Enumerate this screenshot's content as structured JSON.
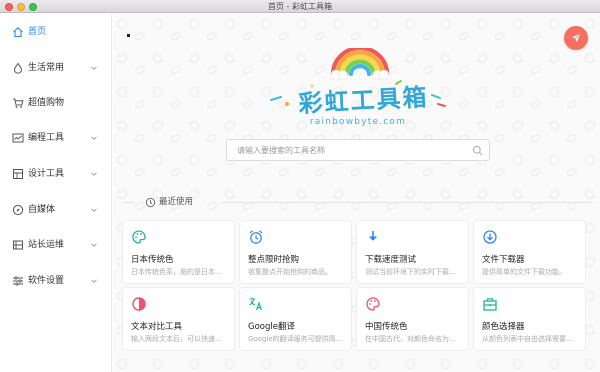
{
  "window": {
    "title": "首页 - 彩虹工具箱"
  },
  "sidebar": {
    "items": [
      {
        "label": "首页",
        "icon": "home-icon",
        "active": true
      },
      {
        "label": "生活常用",
        "icon": "water-drop-icon",
        "expandable": true
      },
      {
        "label": "超值购物",
        "icon": "cart-icon"
      },
      {
        "label": "编程工具",
        "icon": "code-window-icon",
        "expandable": true
      },
      {
        "label": "设计工具",
        "icon": "design-icon",
        "expandable": true
      },
      {
        "label": "自媒体",
        "icon": "compass-icon",
        "expandable": true
      },
      {
        "label": "站长运维",
        "icon": "server-icon",
        "expandable": true
      },
      {
        "label": "软件设置",
        "icon": "sliders-icon",
        "expandable": true
      }
    ]
  },
  "logo": {
    "name": "彩虹工具箱",
    "domain": "rainbowbyte.com"
  },
  "search": {
    "placeholder": "请输入要搜索的工具名称"
  },
  "recent": {
    "label": "最近使用",
    "cards": [
      {
        "title": "日本传统色",
        "desc": "日本传统色系，施的是日本…",
        "icon": "palette-icon",
        "color": "#20b2a0"
      },
      {
        "title": "整点限时抢购",
        "desc": "收集整点开始抢购的商品。",
        "icon": "alarm-clock-icon",
        "color": "#3b8df2"
      },
      {
        "title": "下载速度测试",
        "desc": "测试当前环境下的实时下载…",
        "icon": "download-arrow-icon",
        "color": "#2d86ff"
      },
      {
        "title": "文件下载器",
        "desc": "提供简单的文件下载功能。",
        "icon": "download-circle-icon",
        "color": "#2d86ff"
      },
      {
        "title": "文本对比工具",
        "desc": "输入两段文本后，可以快速…",
        "icon": "contrast-icon",
        "color": "#f0506e"
      },
      {
        "title": "Google翻译",
        "desc": "Google的翻译服务可提供简…",
        "icon": "translate-icon",
        "color": "#20b2a0"
      },
      {
        "title": "中国传统色",
        "desc": "在中国古代，对颜色命名为…",
        "icon": "palette-icon",
        "color": "#f0506e"
      },
      {
        "title": "颜色选择器",
        "desc": "从颜色列表中自由选择需要…",
        "icon": "toolbox-icon",
        "color": "#20b2a0"
      }
    ]
  },
  "colors": {
    "accent": "#2d86ff",
    "rocket": "#f66f60"
  }
}
